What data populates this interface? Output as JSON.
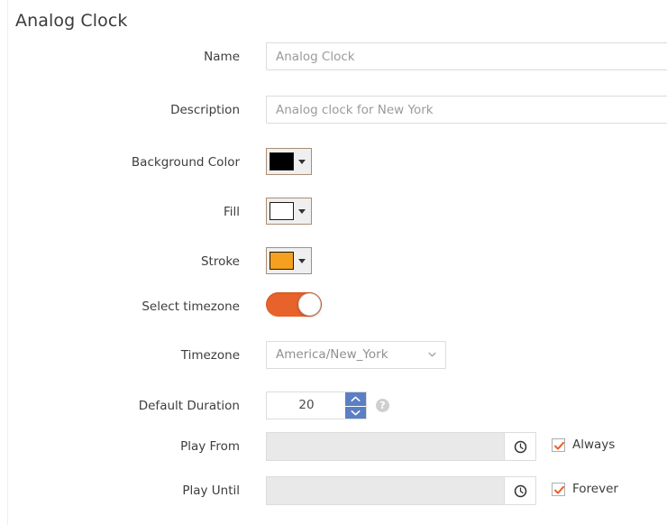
{
  "page": {
    "title": "Analog Clock"
  },
  "fields": {
    "name": {
      "label": "Name",
      "value": "",
      "placeholder": "Analog Clock"
    },
    "description": {
      "label": "Description",
      "value": "",
      "placeholder": "Analog clock for New York"
    },
    "background_color": {
      "label": "Background Color",
      "color": "#000000",
      "caret_icon": "chevron-down-icon"
    },
    "fill": {
      "label": "Fill",
      "color": "#ffffff",
      "caret_icon": "chevron-down-icon"
    },
    "stroke": {
      "label": "Stroke",
      "color": "#f5a01e",
      "caret_icon": "chevron-down-icon"
    },
    "select_timezone": {
      "label": "Select timezone",
      "state": "on",
      "on_color": "#e8622c"
    },
    "timezone": {
      "label": "Timezone",
      "selected": "America/New_York",
      "options": [
        "America/New_York"
      ],
      "chevron_icon": "chevron-down-icon"
    },
    "default_duration": {
      "label": "Default Duration",
      "value": "20",
      "up_icon": "chevron-up-icon",
      "down_icon": "chevron-down-icon",
      "spinner_color": "#5b7fc4",
      "help_icon": "question-mark-icon",
      "help_glyph": "?"
    },
    "play_from": {
      "label": "Play From",
      "value": "",
      "placeholder": "",
      "addon_icon": "clock-icon",
      "checkbox": {
        "label": "Always",
        "checked": true,
        "check_color": "#f05a24"
      }
    },
    "play_until": {
      "label": "Play Until",
      "value": "",
      "placeholder": "",
      "addon_icon": "clock-icon",
      "checkbox": {
        "label": "Forever",
        "checked": true,
        "check_color": "#f05a24"
      }
    }
  }
}
